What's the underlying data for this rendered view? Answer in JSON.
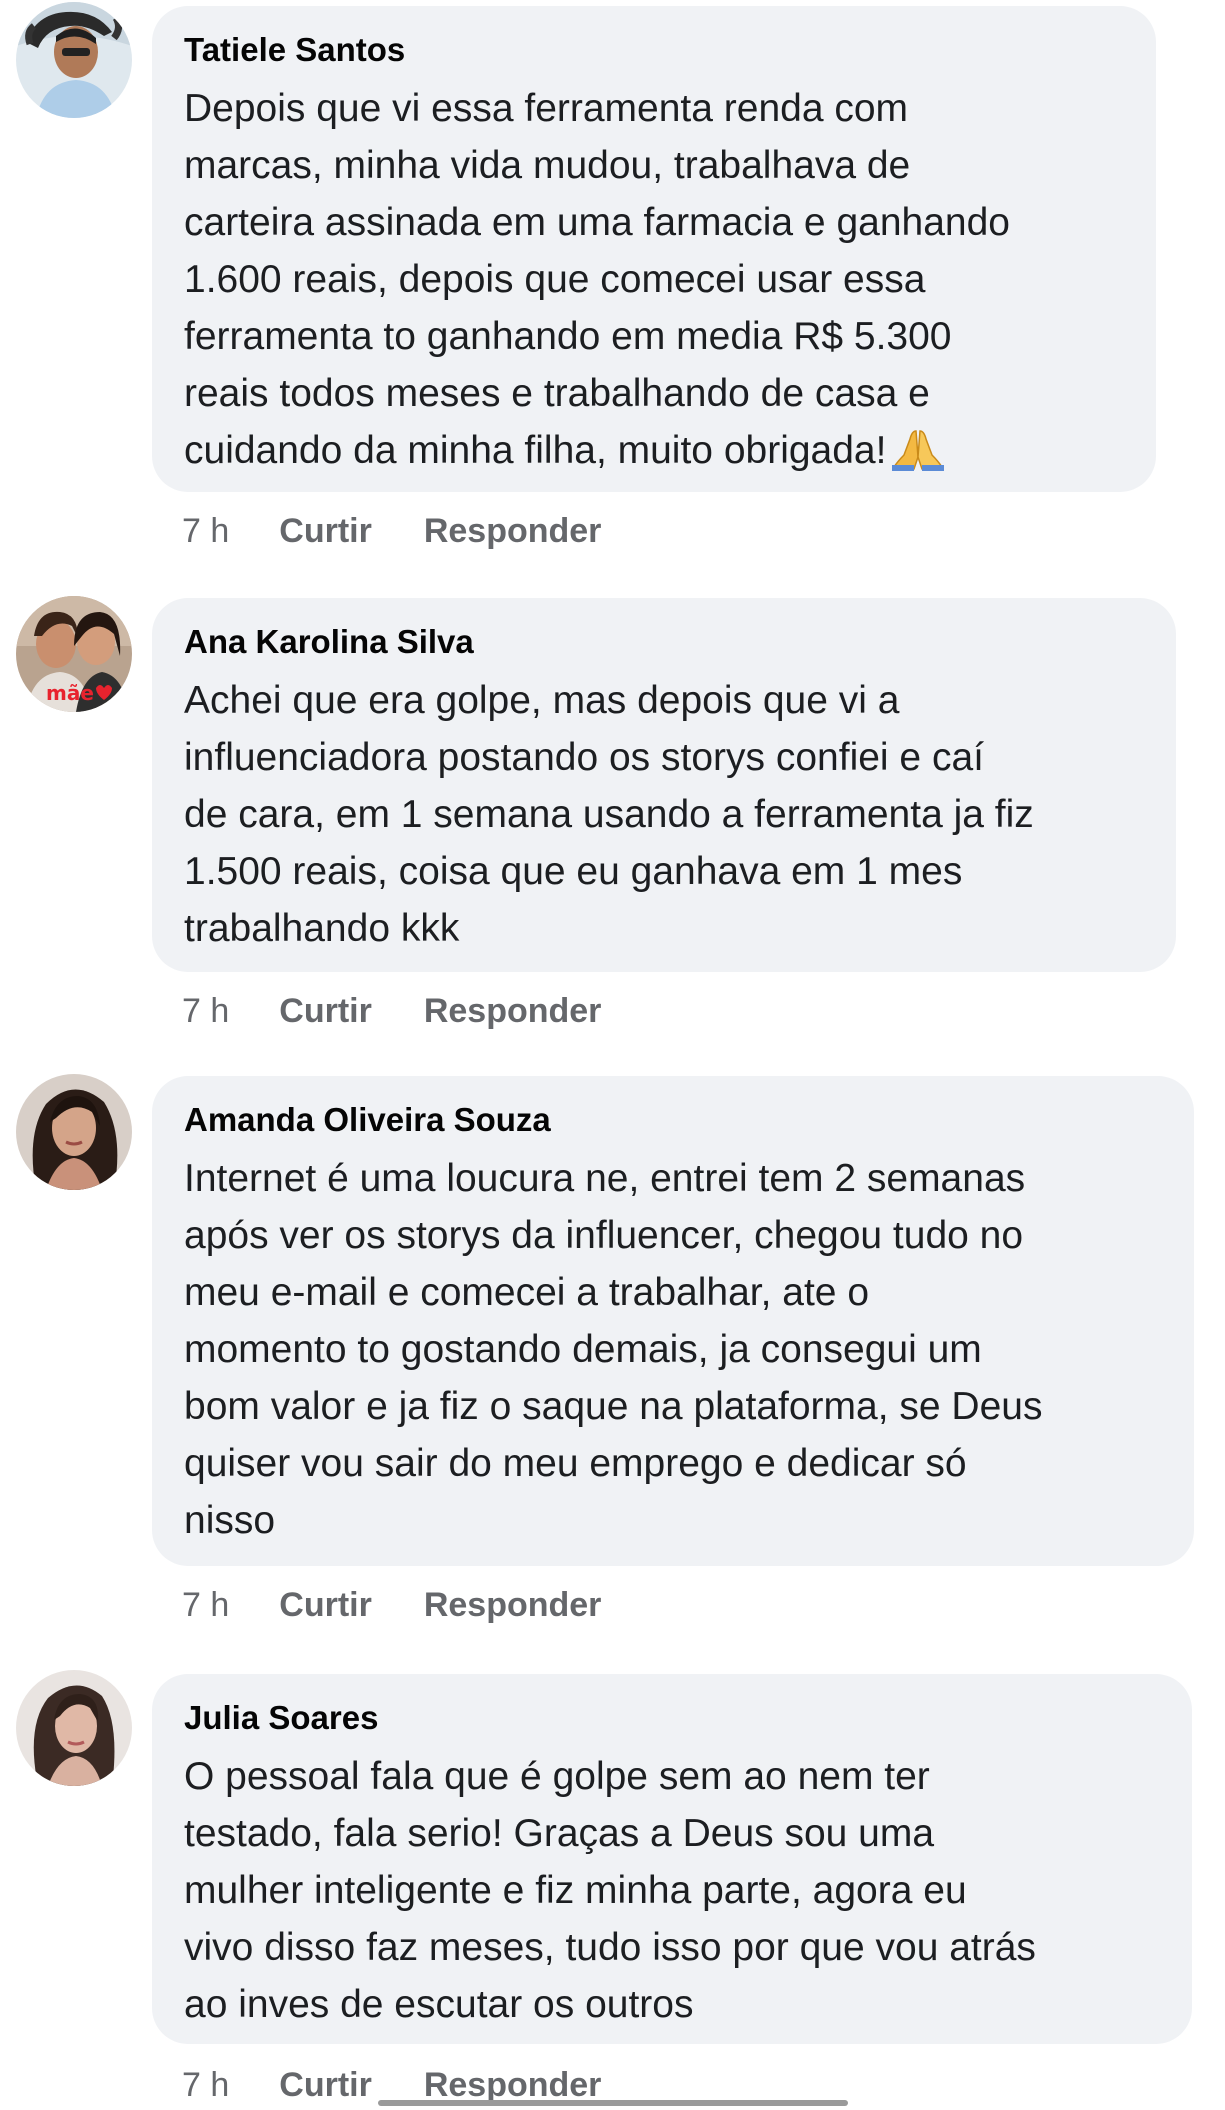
{
  "comments": [
    {
      "author": "Tatiele Santos",
      "text": "Depois que vi essa ferramenta renda com\nmarcas, minha vida mudou, trabalhava de\ncarteira assinada em uma farmacia e ganhando\n1.600 reais, depois que comecei usar essa\nferramenta to ganhando em media R$ 5.300\nreais todos meses e trabalhando de casa e\ncuidando da minha filha, muito obrigada!",
      "emoji": "folded-hands-emoji",
      "time": "7 h",
      "like_label": "Curtir",
      "reply_label": "Responder"
    },
    {
      "author": "Ana Karolina Silva",
      "text": "Achei que era golpe, mas depois que vi a\ninfluenciadora postando os storys confiei e caí\nde cara, em 1 semana usando a ferramenta ja fiz\n1.500 reais, coisa que eu ganhava em 1 mes\ntrabalhando kkk",
      "avatar_caption": "mãe",
      "time": "7 h",
      "like_label": "Curtir",
      "reply_label": "Responder"
    },
    {
      "author": "Amanda Oliveira Souza",
      "text": "Internet é uma loucura ne, entrei tem 2 semanas\napós ver os storys da influencer, chegou tudo no\nmeu e-mail e comecei a trabalhar, ate o\nmomento to gostando demais, ja consegui um\nbom valor e ja fiz o saque na plataforma, se Deus\nquiser vou sair do meu emprego e dedicar só\nnisso",
      "time": "7 h",
      "like_label": "Curtir",
      "reply_label": "Responder"
    },
    {
      "author": "Julia Soares",
      "text": "O pessoal fala que é golpe sem ao nem ter\ntestado, fala serio! Graças a Deus sou uma\nmulher inteligente e fiz minha parte, agora eu\nvivo disso faz meses, tudo isso por que vou atrás\nao inves de escutar os outros",
      "time": "7 h",
      "like_label": "Curtir",
      "reply_label": "Responder"
    }
  ],
  "colors": {
    "bubble": "#f0f2f5",
    "meta": "#65676b",
    "author": "#050505"
  }
}
